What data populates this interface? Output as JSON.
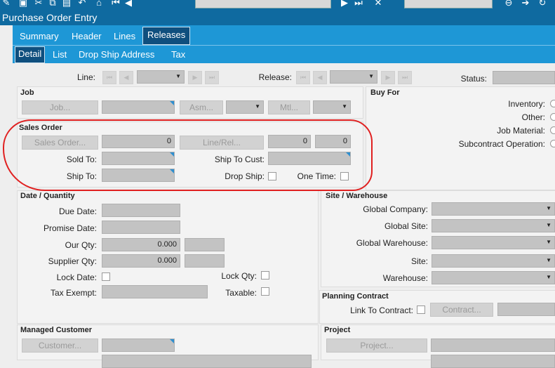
{
  "window": {
    "title": "Purchase Order Entry"
  },
  "tabs_main": [
    "Summary",
    "Header",
    "Lines",
    "Releases"
  ],
  "tabs_main_active": "Releases",
  "tabs_sub": [
    "Detail",
    "List",
    "Drop Ship Address",
    "Tax"
  ],
  "tabs_sub_active": "Detail",
  "top": {
    "line_label": "Line:",
    "release_label": "Release:",
    "status_label": "Status:"
  },
  "job": {
    "title": "Job",
    "job_btn": "Job...",
    "asm_btn": "Asm...",
    "mtl_btn": "Mtl..."
  },
  "buy_for": {
    "title": "Buy For",
    "options": [
      "Inventory:",
      "Other:",
      "Job Material:",
      "Subcontract Operation:"
    ]
  },
  "sales_order": {
    "title": "Sales Order",
    "sales_order_btn": "Sales Order...",
    "sales_order_value": "0",
    "line_rel_btn": "Line/Rel...",
    "line_value": "0",
    "rel_value": "0",
    "sold_to_label": "Sold To:",
    "ship_to_cust_label": "Ship To Cust:",
    "ship_to_label": "Ship To:",
    "drop_ship_label": "Drop Ship:",
    "one_time_label": "One Time:"
  },
  "date_qty": {
    "title": "Date / Quantity",
    "due_date_label": "Due Date:",
    "promise_date_label": "Promise Date:",
    "our_qty_label": "Our Qty:",
    "our_qty_value": "0.000",
    "supplier_qty_label": "Supplier Qty:",
    "supplier_qty_value": "0.000",
    "lock_date_label": "Lock Date:",
    "lock_qty_label": "Lock Qty:",
    "tax_exempt_label": "Tax Exempt:",
    "taxable_label": "Taxable:"
  },
  "site_wh": {
    "title": "Site / Warehouse",
    "labels": [
      "Global Company:",
      "Global Site:",
      "Global Warehouse:",
      "Site:",
      "Warehouse:"
    ]
  },
  "planning": {
    "title": "Planning Contract",
    "link_label": "Link To Contract:",
    "contract_btn": "Contract..."
  },
  "managed_customer": {
    "title": "Managed Customer",
    "customer_btn": "Customer..."
  },
  "project": {
    "title": "Project",
    "project_btn": "Project..."
  },
  "colors": {
    "accent": "#1e97d6",
    "titlebar": "#0f6aa0",
    "active_tab": "#0f4f7e",
    "annotation": "#e02020"
  }
}
